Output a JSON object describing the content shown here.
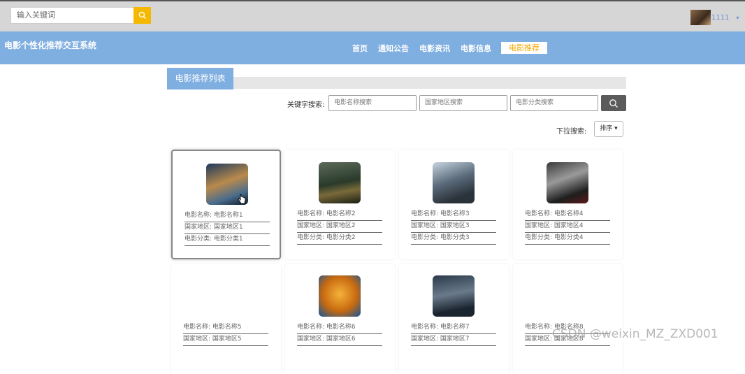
{
  "topbar": {
    "search_placeholder": "输入关键词",
    "user_name": "1111",
    "colors": {
      "search_button": "#f5b800",
      "user": "#6a8fd6"
    }
  },
  "header": {
    "site_title": "电影个性化推荐交互系统",
    "nav": [
      {
        "label": "首页",
        "active": false
      },
      {
        "label": "通知公告",
        "active": false
      },
      {
        "label": "电影资讯",
        "active": false
      },
      {
        "label": "电影信息",
        "active": false
      },
      {
        "label": "电影推荐",
        "active": true
      }
    ],
    "colors": {
      "bar": "#7faee0",
      "active_text": "#f5a800"
    }
  },
  "section": {
    "title": "电影推荐列表"
  },
  "search": {
    "keyword_label": "关键字搜索:",
    "fields": [
      {
        "placeholder": "电影名称搜索"
      },
      {
        "placeholder": "国家地区搜索"
      },
      {
        "placeholder": "电影分类搜索"
      }
    ],
    "search_icon": "search-icon"
  },
  "dropdown": {
    "label": "下拉搜索:",
    "sort_label": "排序"
  },
  "movies": [
    {
      "name_label": "电影名称:",
      "name": "电影名称1",
      "region_label": "国家地区:",
      "region": "国家地区1",
      "category_label": "电影分类:",
      "category": "电影分类1",
      "poster": "poster-blue-fantasy"
    },
    {
      "name_label": "电影名称:",
      "name": "电影名称2",
      "region_label": "国家地区:",
      "region": "国家地区2",
      "category_label": "电影分类:",
      "category": "电影分类2",
      "poster": "poster-war"
    },
    {
      "name_label": "电影名称:",
      "name": "电影名称3",
      "region_label": "国家地区:",
      "region": "国家地区3",
      "category_label": "电影分类:",
      "category": "电影分类3",
      "poster": "poster-action"
    },
    {
      "name_label": "电影名称:",
      "name": "电影名称4",
      "region_label": "国家地区:",
      "region": "国家地区4",
      "category_label": "电影分类:",
      "category": "电影分类4",
      "poster": "poster-crime"
    },
    {
      "name_label": "电影名称:",
      "name": "电影名称5",
      "region_label": "国家地区:",
      "region": "国家地区5",
      "poster": ""
    },
    {
      "name_label": "电影名称:",
      "name": "电影名称6",
      "region_label": "国家地区:",
      "region": "国家地区6",
      "poster": "poster-animation"
    },
    {
      "name_label": "电影名称:",
      "name": "电影名称7",
      "region_label": "国家地区:",
      "region": "国家地区7",
      "poster": "poster-disaster"
    },
    {
      "name_label": "电影名称:",
      "name": "电影名称8",
      "region_label": "国家地区:",
      "region": "国家地区8",
      "poster": ""
    }
  ],
  "watermark": "CSDN @weixin_MZ_ZXD001"
}
